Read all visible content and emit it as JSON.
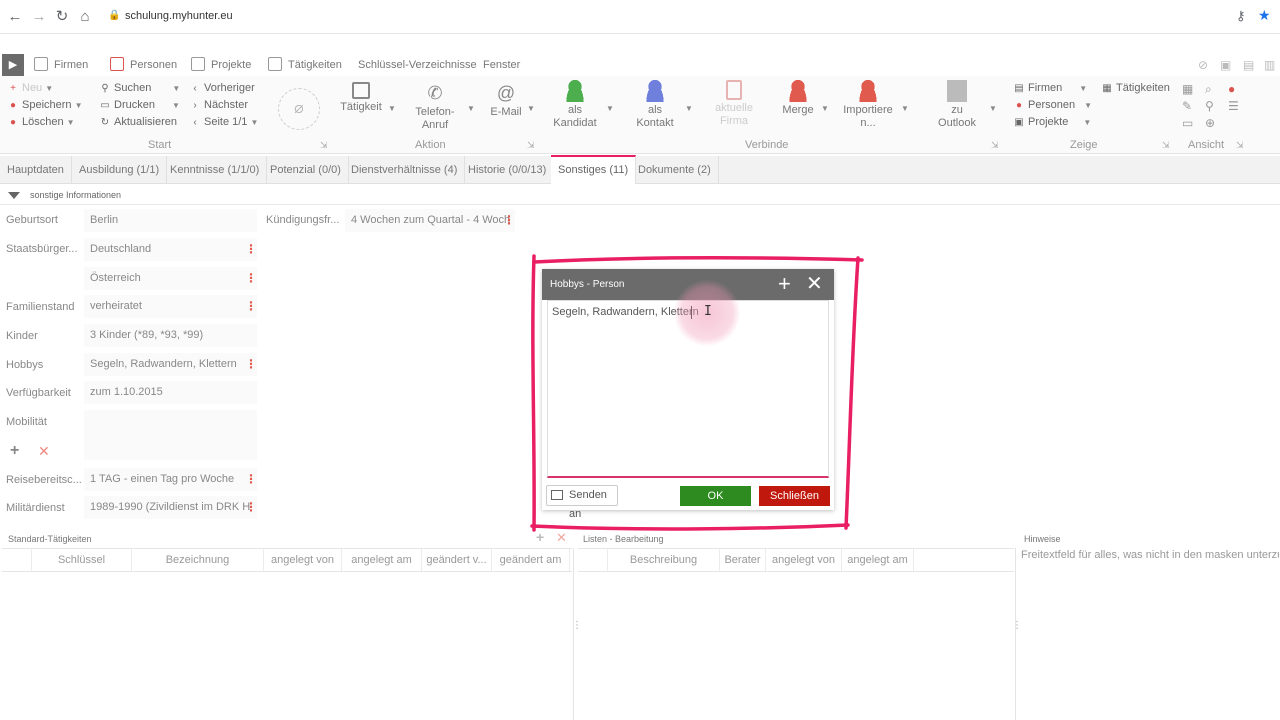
{
  "browser": {
    "url": "schulung.myhunter.eu"
  },
  "menu": {
    "home": "▶",
    "items": [
      "Firmen",
      "Personen",
      "Projekte",
      "Tätigkeiten",
      "Schlüssel-Verzeichnisse",
      "Fenster"
    ]
  },
  "ribbon": {
    "start": {
      "neu": "Neu",
      "speichern": "Speichern",
      "loeschen": "Löschen",
      "suchen": "Suchen",
      "drucken": "Drucken",
      "aktualisieren": "Aktualisieren",
      "vorheriger": "Vorheriger",
      "naechster": "Nächster",
      "seite": "Seite 1/1",
      "label": "Start"
    },
    "aktion": {
      "taetigkeit": "Tätigkeit",
      "telefon1": "Telefon-",
      "telefon2": "Anruf",
      "email": "E-Mail",
      "label": "Aktion"
    },
    "verbinde": {
      "kandidat1": "als",
      "kandidat2": "Kandidat",
      "kontakt1": "als",
      "kontakt2": "Kontakt",
      "firma1": "aktuelle",
      "firma2": "Firma",
      "merge": "Merge",
      "importiere1": "Importiere",
      "importiere2": "n...",
      "label": "Verbinde"
    },
    "outlook": {
      "zu": "zu",
      "outlook": "Outlook"
    },
    "zeige": {
      "firmen": "Firmen",
      "personen": "Personen",
      "projekte": "Projekte",
      "taetigkeiten": "Tätigkeiten",
      "label": "Zeige"
    },
    "ansicht": {
      "label": "Ansicht"
    }
  },
  "tabs": [
    "Hauptdaten",
    "Ausbildung (1/1)",
    "Kenntnisse (1/1/0)",
    "Potenzial (0/0)",
    "Dienstverhältnisse (4)",
    "Historie (0/0/13)",
    "Sonstiges (11)",
    "Dokumente (2)"
  ],
  "section": "sonstige Informationen",
  "fields": {
    "geburtsort": {
      "label": "Geburtsort",
      "value": "Berlin"
    },
    "staatsbuerger": {
      "label": "Staatsbürger...",
      "value": "Deutschland",
      "value2": "Österreich"
    },
    "familienstand": {
      "label": "Familienstand",
      "value": "verheiratet"
    },
    "kinder": {
      "label": "Kinder",
      "value": "3 Kinder (*89, *93, *99)"
    },
    "hobbys": {
      "label": "Hobbys",
      "value": "Segeln, Radwandern, Klettern"
    },
    "verfuegbarkeit": {
      "label": "Verfügbarkeit",
      "value": "zum 1.10.2015"
    },
    "mobilitaet": {
      "label": "Mobilität",
      "value": ""
    },
    "reise": {
      "label": "Reisebereitsc...",
      "value": "1 TAG - einen Tag pro Woche"
    },
    "militaer": {
      "label": "Militärdienst",
      "value": "1989-1990 (Zivildienst im DRK H"
    },
    "kuendigung": {
      "label": "Kündigungsfr...",
      "value": "4 Wochen zum Quartal - 4 Woch"
    }
  },
  "panels": {
    "standard": {
      "title": "Standard-Tätigkeiten",
      "columns": [
        "Schlüssel",
        "Bezeichnung",
        "angelegt von",
        "angelegt am",
        "geändert v...",
        "geändert am"
      ]
    },
    "listen": {
      "title": "Listen - Bearbeitung",
      "columns": [
        "Beschreibung",
        "Berater",
        "angelegt von",
        "angelegt am"
      ]
    },
    "hinweise": {
      "title": "Hinweise",
      "text": "Freitextfeld für alles, was nicht in den masken unterzub"
    }
  },
  "modal": {
    "title": "Hobbys - Person",
    "text": "Segeln, Radwandern, Klettern",
    "send": "Senden an",
    "ok": "OK",
    "close": "Schließen"
  },
  "colors": {
    "accent": "#e91e63",
    "ok": "#2e8b1f",
    "close": "#c0180c"
  }
}
